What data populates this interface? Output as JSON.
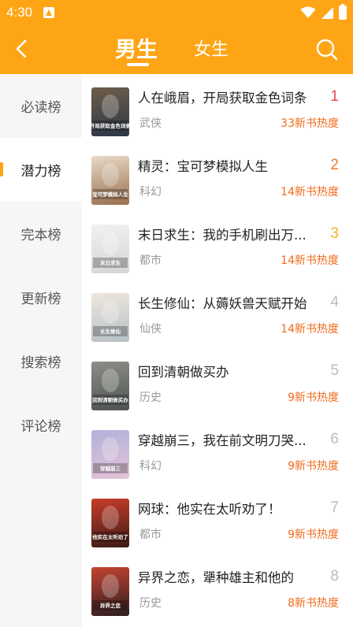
{
  "status_bar": {
    "time": "4:30"
  },
  "header": {
    "tabs": [
      {
        "label": "男生",
        "active": true
      },
      {
        "label": "女生",
        "active": false
      }
    ]
  },
  "sidebar": {
    "items": [
      {
        "label": "必读榜",
        "active": false
      },
      {
        "label": "潜力榜",
        "active": true
      },
      {
        "label": "完本榜",
        "active": false
      },
      {
        "label": "更新榜",
        "active": false
      },
      {
        "label": "搜索榜",
        "active": false
      },
      {
        "label": "评论榜",
        "active": false
      }
    ]
  },
  "books": [
    {
      "rank": "1",
      "title": "人在峨眉，开局获取金色词条",
      "category": "武侠",
      "heat": "33新书热度",
      "rank_color": "#f04848",
      "cover_colors": [
        "#6e5e4a",
        "#2c3645"
      ],
      "cover_text": "开局获取金色词条"
    },
    {
      "rank": "2",
      "title": "精灵：宝可梦模拟人生",
      "category": "科幻",
      "heat": "14新书热度",
      "rank_color": "#f07a2a",
      "cover_colors": [
        "#e7d9c7",
        "#9a6f4e"
      ],
      "cover_text": "宝可梦模拟人生"
    },
    {
      "rank": "3",
      "title": "末日求生：我的手机刷出万...",
      "category": "都市",
      "heat": "14新书热度",
      "rank_color": "#f2b41c",
      "cover_colors": [
        "#f1f1f1",
        "#d5d5d5"
      ],
      "cover_text": "末日求生"
    },
    {
      "rank": "4",
      "title": "长生修仙：从薅妖兽天赋开始",
      "category": "仙侠",
      "heat": "14新书热度",
      "rank_color": "#b8bcc4",
      "cover_colors": [
        "#eee6dc",
        "#b7c1c8"
      ],
      "cover_text": "长生修仙"
    },
    {
      "rank": "5",
      "title": "回到清朝做买办",
      "category": "历史",
      "heat": "9新书热度",
      "rank_color": "#b8bcc4",
      "cover_colors": [
        "#8c8e88",
        "#4e5350"
      ],
      "cover_text": "回到清朝做买办"
    },
    {
      "rank": "6",
      "title": "穿越崩三，我在前文明刀哭...",
      "category": "科幻",
      "heat": "9新书热度",
      "rank_color": "#b8bcc4",
      "cover_colors": [
        "#b3b2dc",
        "#e5c3d7"
      ],
      "cover_text": "穿越崩三"
    },
    {
      "rank": "7",
      "title": "网球：他实在太听劝了！",
      "category": "都市",
      "heat": "9新书热度",
      "rank_color": "#b8bcc4",
      "cover_colors": [
        "#c93d2a",
        "#3a1b16"
      ],
      "cover_text": "他实在太听劝了"
    },
    {
      "rank": "8",
      "title": "异界之恋，犟种雄主和他的",
      "category": "历史",
      "heat": "8新书热度",
      "rank_color": "#b8bcc4",
      "cover_colors": [
        "#c4432f",
        "#2d1e22"
      ],
      "cover_text": "异界之恋"
    }
  ],
  "colors": {
    "brand": "#fea516",
    "heat_text": "#f26a1b"
  }
}
